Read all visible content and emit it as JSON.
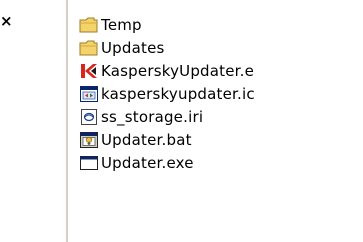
{
  "left_panel": {
    "close_glyph": "×"
  },
  "file_list": {
    "items": [
      {
        "label": "Temp",
        "icon": "folder-icon",
        "type": "folder"
      },
      {
        "label": "Updates",
        "icon": "folder-icon",
        "type": "folder"
      },
      {
        "label": "KasperskyUpdater.e",
        "icon": "kaspersky-k-icon",
        "type": "file"
      },
      {
        "label": "kasperskyupdater.ic",
        "icon": "window-file-icon",
        "type": "file"
      },
      {
        "label": "ss_storage.iri",
        "icon": "iri-file-icon",
        "type": "file"
      },
      {
        "label": "Updater.bat",
        "icon": "batch-file-icon",
        "type": "file"
      },
      {
        "label": "Updater.exe",
        "icon": "exe-file-icon",
        "type": "file"
      }
    ]
  },
  "colors": {
    "folder": "#f4d36a",
    "kaspersky": "#d9251c",
    "window_title": "#0a246a"
  }
}
